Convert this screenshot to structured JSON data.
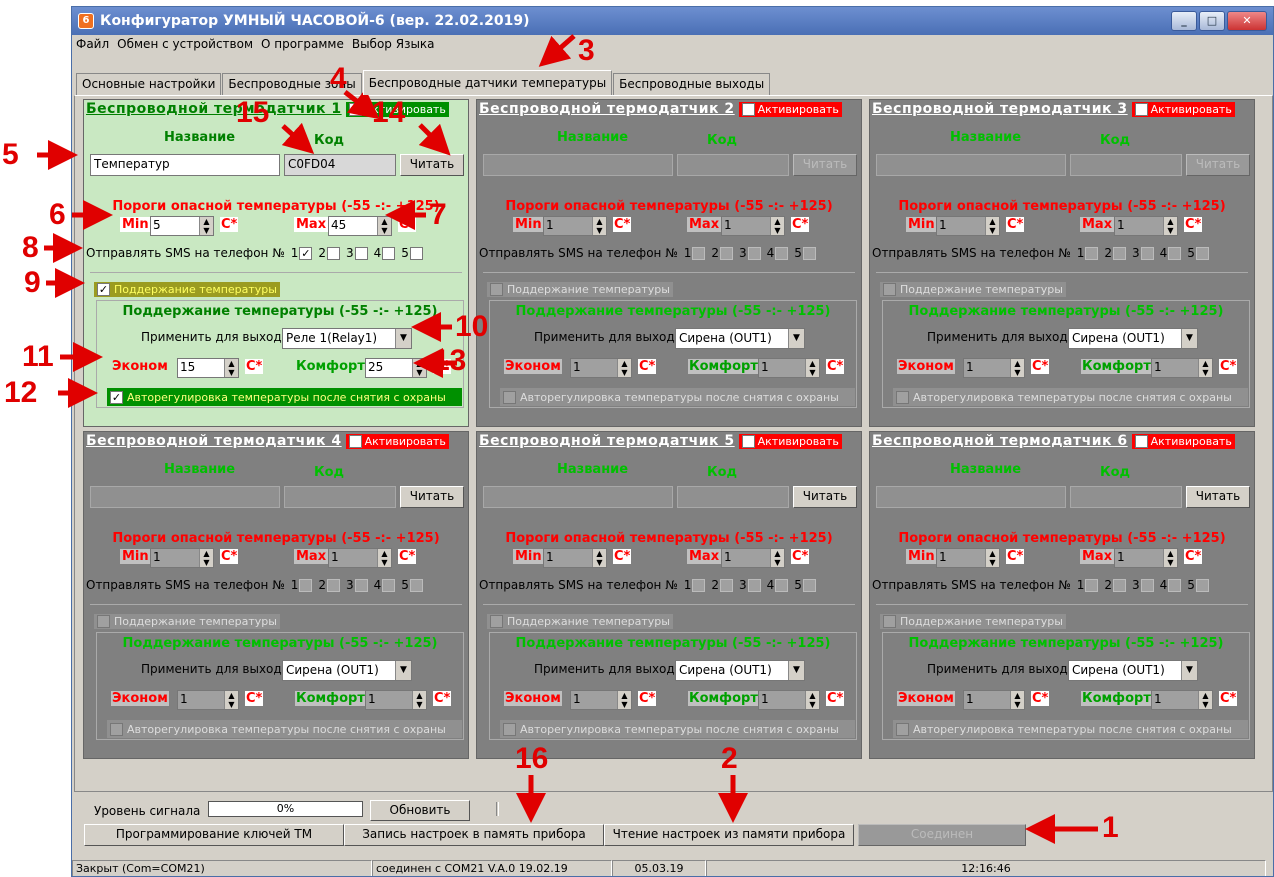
{
  "window": {
    "title": "Конфигуратор УМНЫЙ ЧАСОВОЙ-6 (вер. 22.02.2019)",
    "icon_letter": "6"
  },
  "menu": [
    "Файл",
    "Обмен с устройством",
    "О программе",
    "Выбор Языка"
  ],
  "tabs": [
    "Основные настройки",
    "Беспроводные зоны",
    "Беспроводные датчики температуры",
    "Беспроводные выходы"
  ],
  "labels": {
    "activate": "Активировать",
    "name": "Название",
    "code": "Код",
    "read": "Читать",
    "thresholds": "Пороги опасной температуры (-55 -:- +125)",
    "min": "Min",
    "max": "Max",
    "deg": "C*",
    "sms": "Отправлять SMS на телефон №",
    "support": "Поддержание температуры",
    "support_title": "Поддержание температуры (-55 -:- +125)",
    "apply": "Применить для выхода:",
    "econom": "Эконом",
    "comfort": "Комфорт",
    "auto": "Авторегулировка температуры после снятия с охраны"
  },
  "sms_numbers": [
    "1",
    "2",
    "3",
    "4",
    "5"
  ],
  "sensors": [
    {
      "title": "Беспроводной термодатчик 1",
      "active": true,
      "name": "Температур",
      "code": "C0FD04",
      "min": "5",
      "max": "45",
      "sms": [
        true,
        false,
        false,
        false,
        false
      ],
      "support": true,
      "output": "Реле 1(Relay1)",
      "econom": "15",
      "comfort": "25",
      "auto": true
    },
    {
      "title": "Беспроводной термодатчик 2",
      "active": false,
      "name": "",
      "code": "",
      "min": "1",
      "max": "1",
      "sms": [
        false,
        false,
        false,
        false,
        false
      ],
      "support": false,
      "output": "Сирена (OUT1)",
      "econom": "1",
      "comfort": "1",
      "auto": false
    },
    {
      "title": "Беспроводной термодатчик 3",
      "active": false,
      "name": "",
      "code": "",
      "min": "1",
      "max": "1",
      "sms": [
        false,
        false,
        false,
        false,
        false
      ],
      "support": false,
      "output": "Сирена (OUT1)",
      "econom": "1",
      "comfort": "1",
      "auto": false
    },
    {
      "title": "Беспроводной термодатчик 4",
      "active": false,
      "name": "",
      "code": "",
      "min": "1",
      "max": "1",
      "sms": [
        false,
        false,
        false,
        false,
        false
      ],
      "support": false,
      "output": "Сирена (OUT1)",
      "econom": "1",
      "comfort": "1",
      "auto": false
    },
    {
      "title": "Беспроводной термодатчик 5",
      "active": false,
      "name": "",
      "code": "",
      "min": "1",
      "max": "1",
      "sms": [
        false,
        false,
        false,
        false,
        false
      ],
      "support": false,
      "output": "Сирена (OUT1)",
      "econom": "1",
      "comfort": "1",
      "auto": false
    },
    {
      "title": "Беспроводной термодатчик 6",
      "active": false,
      "name": "",
      "code": "",
      "min": "1",
      "max": "1",
      "sms": [
        false,
        false,
        false,
        false,
        false
      ],
      "support": false,
      "output": "Сирена (OUT1)",
      "econom": "1",
      "comfort": "1",
      "auto": false
    }
  ],
  "signal": {
    "label": "Уровень сигнала",
    "value": "0%",
    "refresh": "Обновить"
  },
  "actions": {
    "keys": "Программирование ключей ТМ",
    "write": "Запись настроек в память прибора",
    "read": "Чтение настроек из памяти прибора",
    "connected": "Соединен"
  },
  "status": {
    "port": "Закрыт (Com=COM21)",
    "conn": "соединен с COM21  V.A.0 19.02.19",
    "date": "05.03.19",
    "time": "12:16:46"
  },
  "annotations": [
    "1",
    "2",
    "3",
    "4",
    "5",
    "6",
    "7",
    "8",
    "9",
    "10",
    "11",
    "12",
    "13",
    "14",
    "15",
    "16"
  ]
}
